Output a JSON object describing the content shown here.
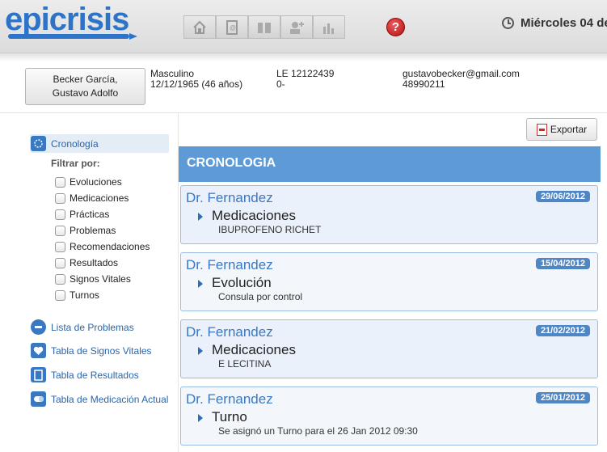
{
  "header": {
    "logo_text": "epicrisis",
    "nav_icons": [
      "home-icon",
      "contacts-icon",
      "people-icon",
      "add-user-icon",
      "stats-icon"
    ],
    "help_label": "?",
    "date_text": "Miércoles 04 de"
  },
  "patient": {
    "name_line1": "Becker García,",
    "name_line2": "Gustavo Adolfo",
    "sex": "Masculino",
    "birth": "12/12/1965  (46 años)",
    "doc_id": "LE 12122439",
    "doc_extra": "0-",
    "email": "gustavobecker@gmail.com",
    "phone": "48990211"
  },
  "sidebar": {
    "cronologia": "Cronología",
    "filter_label": "Filtrar por:",
    "filters": [
      "Evoluciones",
      "Medicaciones",
      "Prácticas",
      "Problemas",
      "Recomendaciones",
      "Resultados",
      "Signos Vitales",
      "Turnos"
    ],
    "links": [
      "Lista de Problemas",
      "Tabla de Signos Vitales",
      "Tabla de Resultados",
      "Tabla de Medicación Actual"
    ]
  },
  "main": {
    "export_label": "Exportar",
    "section_title": "CRONOLOGIA",
    "entries": [
      {
        "doctor": "Dr. Fernandez",
        "date": "29/06/2012",
        "type": "Medicaciones",
        "desc": "IBUPROFENO RICHET"
      },
      {
        "doctor": "Dr. Fernandez",
        "date": "15/04/2012",
        "type": "Evolución",
        "desc": "Consula por control"
      },
      {
        "doctor": "Dr. Fernandez",
        "date": "21/02/2012",
        "type": "Medicaciones",
        "desc": "E LECITINA"
      },
      {
        "doctor": "Dr. Fernandez",
        "date": "25/01/2012",
        "type": "Turno",
        "desc": "Se asignó un Turno para el 26 Jan 2012 09:30"
      }
    ]
  },
  "colors": {
    "brand_blue": "#2d74c8",
    "section_header": "#5e9bd6",
    "date_badge": "#4f86c6",
    "help_red": "#c81f1f"
  }
}
